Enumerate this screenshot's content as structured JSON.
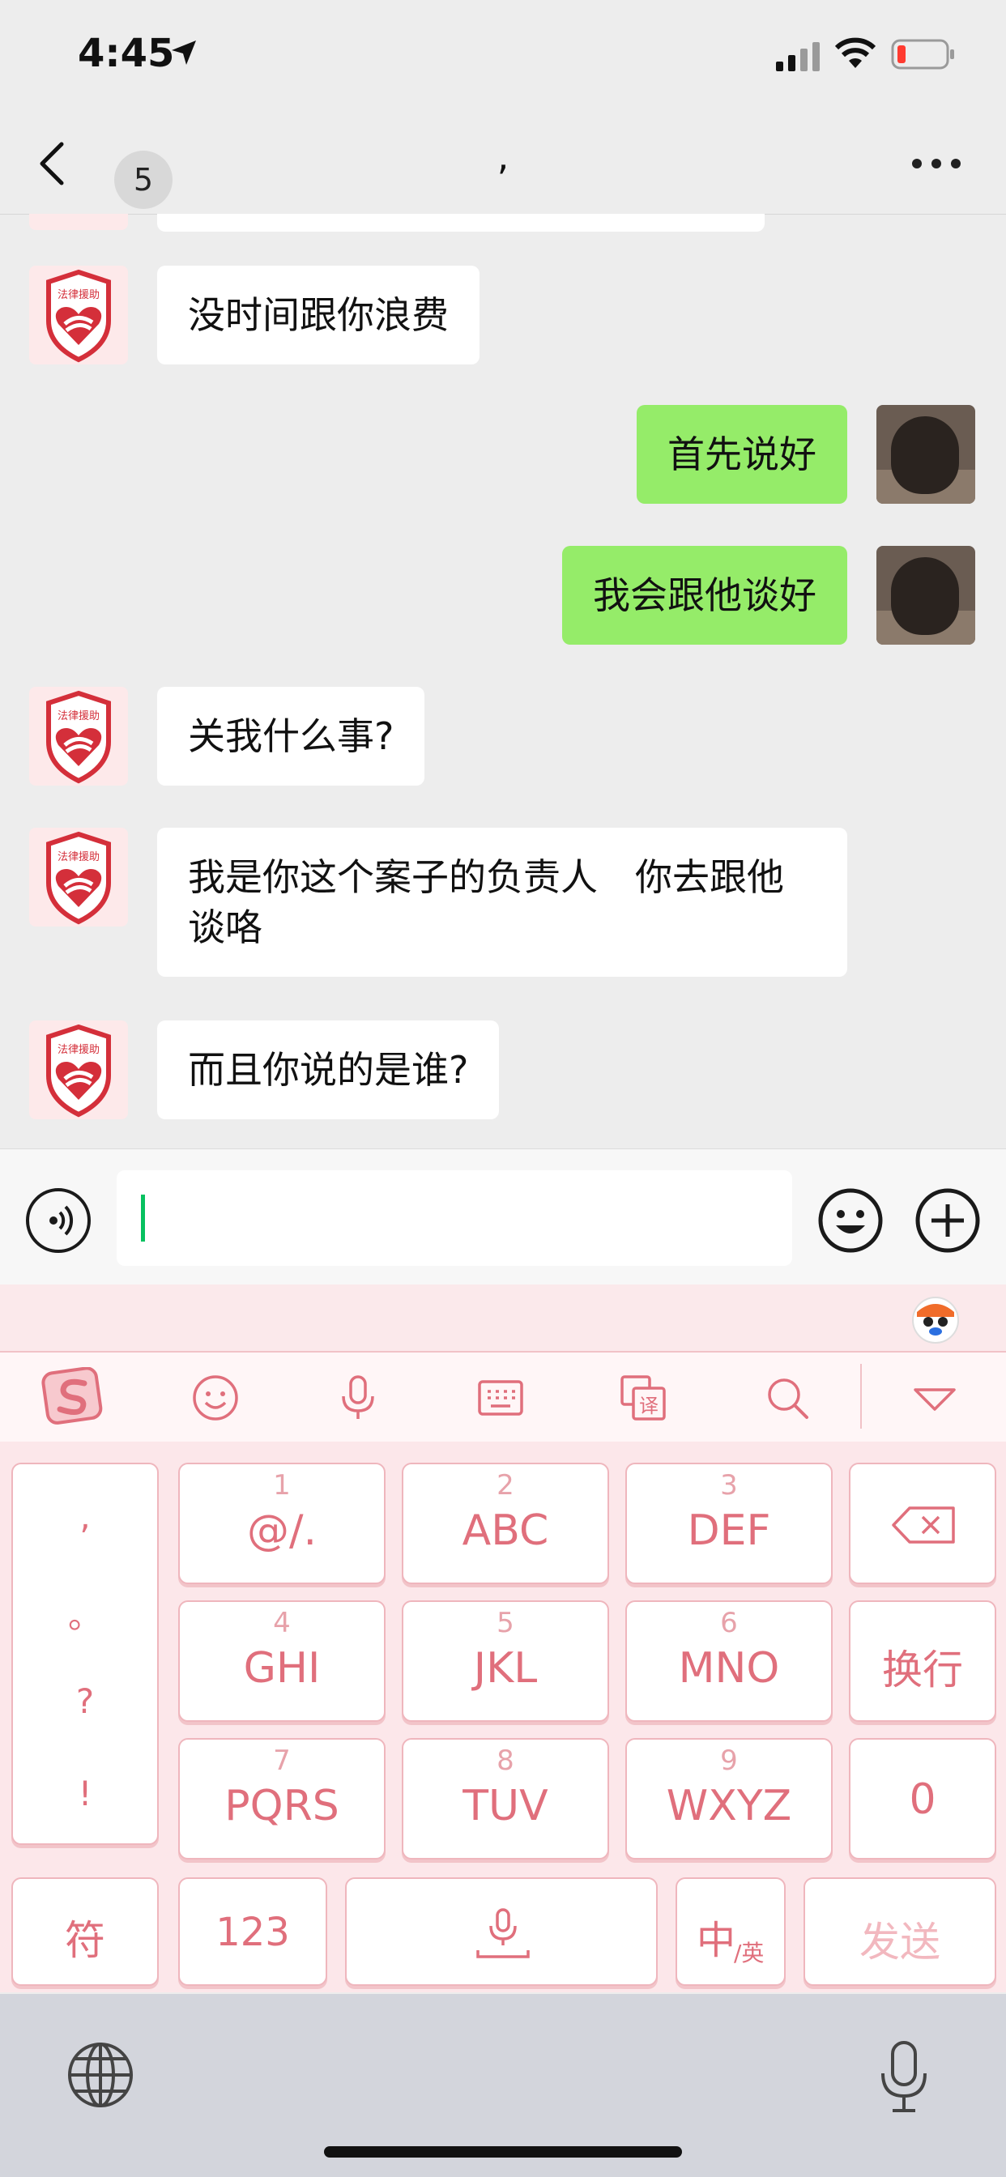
{
  "status": {
    "time": "4:45"
  },
  "nav": {
    "unread_count": "5",
    "title": ","
  },
  "messages": [
    {
      "dir": "in",
      "text": "没时间跟你浪费"
    },
    {
      "dir": "out",
      "text": "首先说好"
    },
    {
      "dir": "out",
      "text": "我会跟他谈好"
    },
    {
      "dir": "in",
      "text": "关我什么事?"
    },
    {
      "dir": "in",
      "text": "我是你这个案子的负责人　你去跟他谈咯"
    },
    {
      "dir": "in",
      "text": "而且你说的是谁?"
    }
  ],
  "avatar_in": {
    "label": "法律援助",
    "color": "#d42f3a"
  },
  "input": {
    "value": ""
  },
  "keyboard": {
    "punct": [
      ",",
      "。",
      "?",
      "!"
    ],
    "keys": [
      {
        "num": "1",
        "label": "@/."
      },
      {
        "num": "2",
        "label": "ABC"
      },
      {
        "num": "3",
        "label": "DEF"
      },
      {
        "num": "4",
        "label": "GHI"
      },
      {
        "num": "5",
        "label": "JKL"
      },
      {
        "num": "6",
        "label": "MNO"
      },
      {
        "num": "7",
        "label": "PQRS"
      },
      {
        "num": "8",
        "label": "TUV"
      },
      {
        "num": "9",
        "label": "WXYZ"
      }
    ],
    "newline": "换行",
    "zero": "0",
    "symbol": "符",
    "numbers": "123",
    "lang_main": "中",
    "lang_sub": "/英",
    "send": "发送"
  },
  "colors": {
    "accent_green": "#95ec69",
    "keyboard_pink": "#e06f7c"
  }
}
